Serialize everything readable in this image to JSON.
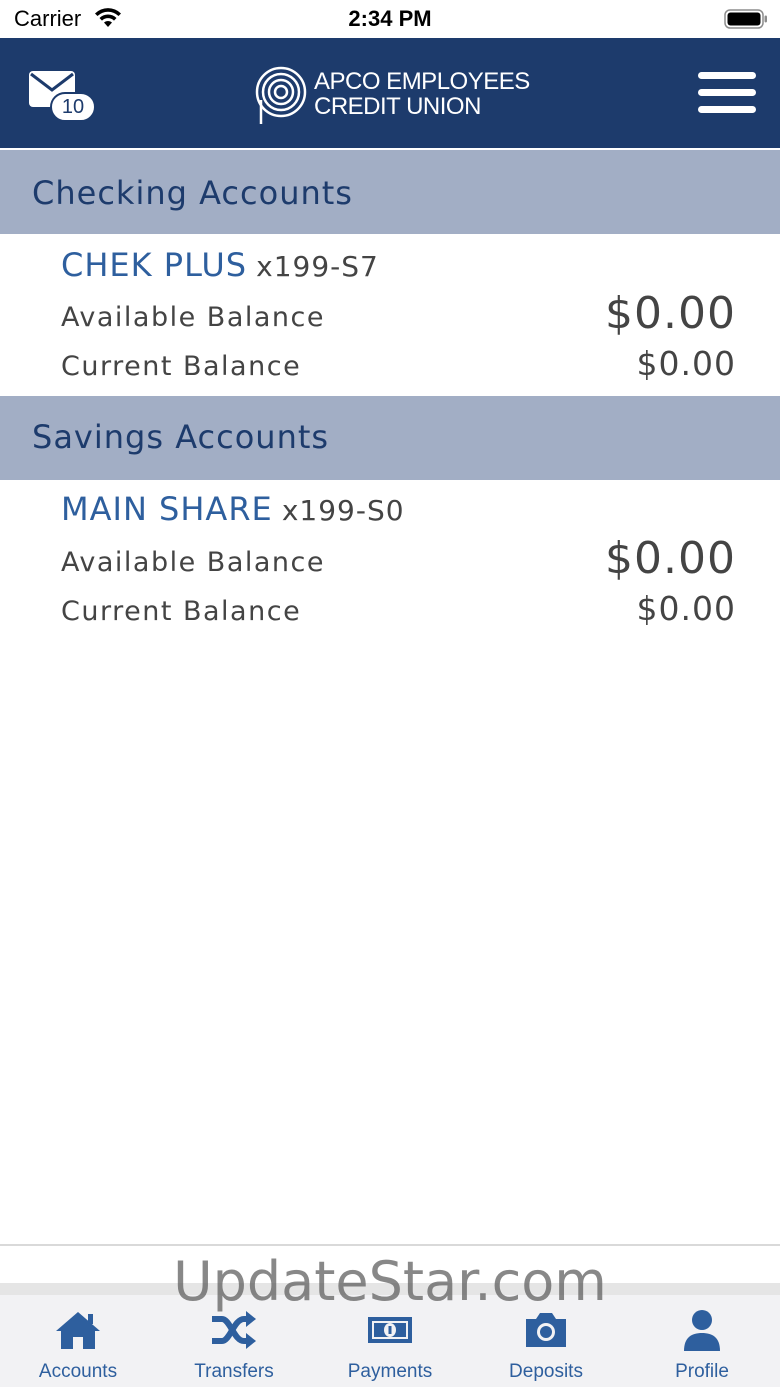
{
  "status_bar": {
    "carrier": "Carrier",
    "time": "2:34 PM"
  },
  "header": {
    "mail_badge_count": "10",
    "logo_line1": "APCO EMPLOYEES",
    "logo_line2": "CREDIT UNION",
    "brand_color": "#1d3b6c"
  },
  "sections": [
    {
      "title": "Checking Accounts",
      "accounts": [
        {
          "name": "CHEK PLUS",
          "number": "x199-S7",
          "available_label": "Available Balance",
          "available_value": "$0.00",
          "current_label": "Current Balance",
          "current_value": "$0.00"
        }
      ]
    },
    {
      "title": "Savings Accounts",
      "accounts": [
        {
          "name": "MAIN SHARE",
          "number": "x199-S0",
          "available_label": "Available Balance",
          "available_value": "$0.00",
          "current_label": "Current Balance",
          "current_value": "$0.00"
        }
      ]
    }
  ],
  "tabs": [
    {
      "label": "Accounts",
      "icon": "home-icon"
    },
    {
      "label": "Transfers",
      "icon": "shuffle-icon"
    },
    {
      "label": "Payments",
      "icon": "money-icon"
    },
    {
      "label": "Deposits",
      "icon": "camera-icon"
    },
    {
      "label": "Profile",
      "icon": "person-icon"
    }
  ],
  "watermark": "UpdateStar.com"
}
